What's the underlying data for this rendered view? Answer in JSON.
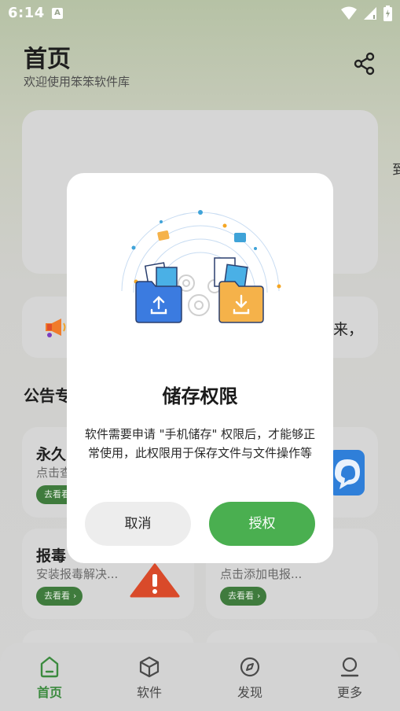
{
  "status_bar": {
    "time": "6:14",
    "notification_badge": "A"
  },
  "header": {
    "title": "首页",
    "subtitle": "欢迎使用笨笨软件库"
  },
  "banner_edge_text": "到",
  "notice": {
    "text": "来，"
  },
  "section": {
    "title": "公告专"
  },
  "cards": [
    {
      "title": "永久",
      "desc": "点击查",
      "action": "去看看",
      "icon": "chat-icon"
    },
    {
      "title": "报毒",
      "desc": "安装报毒解决...",
      "action": "去看看",
      "icon": "warning-icon"
    },
    {
      "title": "",
      "desc": "点击添加电报...",
      "action": "去看看",
      "icon": ""
    }
  ],
  "bottom_nav": [
    {
      "label": "首页",
      "icon": "home-icon",
      "active": true
    },
    {
      "label": "软件",
      "icon": "cube-icon",
      "active": false
    },
    {
      "label": "发现",
      "icon": "compass-icon",
      "active": false
    },
    {
      "label": "更多",
      "icon": "person-icon",
      "active": false
    }
  ],
  "dialog": {
    "title": "储存权限",
    "message": "软件需要申请 \"手机储存\" 权限后，才能够正常使用，此权限用于保存文件与文件操作等",
    "cancel_label": "取消",
    "confirm_label": "授权"
  },
  "colors": {
    "accent": "#4aaf50",
    "dialog_bg": "#ffffff",
    "overlay_page": "#d2d2d2"
  }
}
